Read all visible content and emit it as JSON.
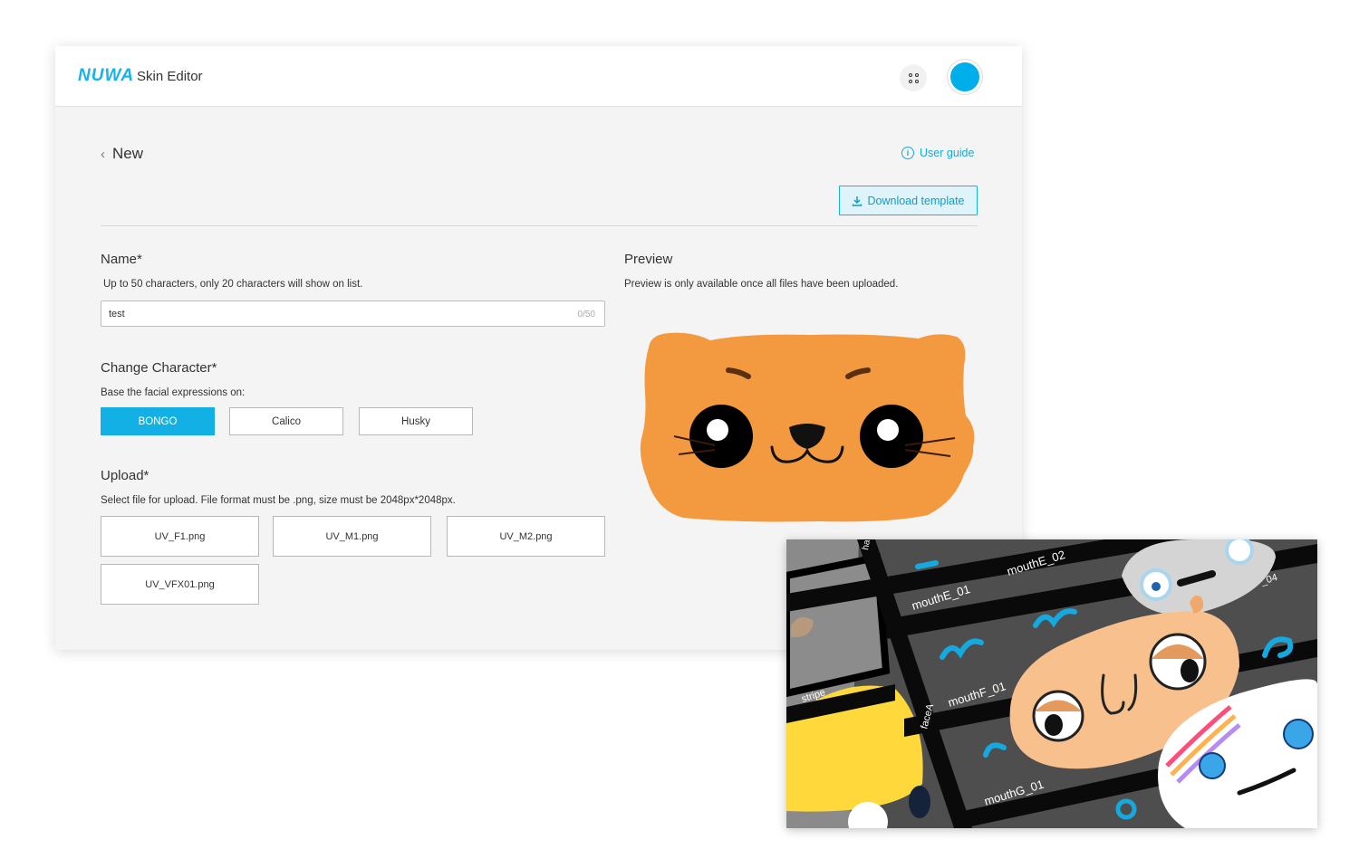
{
  "header": {
    "logo": "NUWA",
    "app_title": "Skin Editor"
  },
  "page": {
    "back_label": "New",
    "user_guide_label": "User guide",
    "download_label": "Download template"
  },
  "name_section": {
    "label": "Name*",
    "help": "Up to 50 characters, only 20 characters will show on list.",
    "value": "test",
    "counter": "0/50"
  },
  "character_section": {
    "label": "Change Character*",
    "help": "Base the facial expressions on:",
    "options": [
      "BONGO",
      "Calico",
      "Husky"
    ],
    "selected": "BONGO"
  },
  "upload_section": {
    "label": "Upload*",
    "help": "Select file for upload. File format must be .png, size must be 2048px*2048px.",
    "files": [
      "UV_F1.png",
      "UV_M1.png",
      "UV_M2.png",
      "UV_VFX01.png"
    ]
  },
  "preview_section": {
    "label": "Preview",
    "help": "Preview is only available once all files have been uploaded."
  },
  "uv_texture": {
    "labels": [
      "mouthE_01",
      "mouthE_02",
      "mouthF_01",
      "mouthG_01",
      "stripe",
      "faceA",
      "_04",
      "ha"
    ]
  },
  "colors": {
    "accent": "#12b0e4",
    "cat_orange": "#f39a40",
    "background": "#f4f4f4"
  }
}
